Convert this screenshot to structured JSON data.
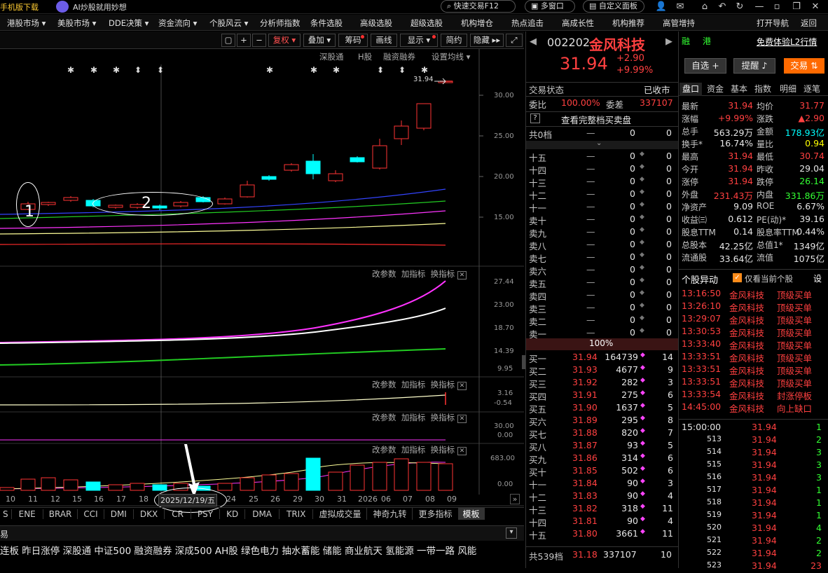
{
  "topbar": {
    "download": "手机版下载",
    "ai": "AI炒股就用妙想",
    "quick": "快速交易F12",
    "multi": "多窗口",
    "custom": "自定义面板"
  },
  "menu": [
    "港股市场 ▾",
    "美股市场 ▾",
    "DDE决策 ▾",
    "资金流向 ▾",
    "个股风云 ▾",
    "分析师指数",
    "条件选股",
    "高级选股",
    "超级选股",
    "机构增仓",
    "热点追击",
    "高成长性",
    "机构推荐",
    "高管增持",
    "打开导航",
    "返回"
  ],
  "toolbar": {
    "restore": "复权",
    "overlay": "叠加",
    "chips": "筹码",
    "draw": "画线",
    "display": "显示",
    "simple": "简约",
    "hide": "隐藏"
  },
  "sublinks": {
    "sgt": "深股通",
    "h": "H股",
    "margin": "融资融券",
    "ma": "设置均线"
  },
  "chart": {
    "last_label": "31.94",
    "yticks": [
      "30.00",
      "25.00",
      "20.00",
      "15.00"
    ],
    "ind_btns": [
      "改参数",
      "加指标",
      "换指标"
    ],
    "ind1_ticks": [
      "27.44",
      "23.00",
      "18.70",
      "14.39",
      "9.95"
    ],
    "ind2_ticks": [
      "3.16",
      "-0.54"
    ],
    "ind3_ticks": [
      "30.00",
      "0.00"
    ],
    "vol_ticks": [
      "683.00",
      "0.00"
    ],
    "xlabels": [
      "10",
      "11",
      "12",
      "15",
      "16",
      "17",
      "18",
      "2025/12/19/五",
      "24",
      "25",
      "26",
      "29",
      "30",
      "31",
      "2026",
      "06",
      "07",
      "08",
      "09"
    ],
    "annotation1": "1",
    "annotation2": "2"
  },
  "bottomtabs": [
    "S",
    "ENE",
    "BRAR",
    "CCI",
    "DMI",
    "DKX",
    "CR",
    "PSY",
    "KD",
    "DMA",
    "TRIX",
    "虚拟成交量",
    "神奇九转",
    "更多指标",
    "模板"
  ],
  "ticker": [
    "连板",
    "昨日涨停",
    "深股通",
    "中证500",
    "融资融券",
    "深成500",
    "AH股",
    "绿色电力",
    "抽水蓄能",
    "储能",
    "商业航天",
    "氢能源",
    "一带一路",
    "风能"
  ],
  "stock": {
    "code": "002202",
    "name": "金风科技",
    "price": "31.94",
    "chg": "+2.90",
    "pct": "+9.99%",
    "rong": "融",
    "gang": "港",
    "trial": "免费体验L2行情",
    "status_l": "交易状态",
    "status_r": "已收市",
    "weibi_l": "委比",
    "weibi": "100.00%",
    "weicha_l": "委差",
    "weicha": "337107",
    "full": "查看完整档买卖盘",
    "gong0": "共0档",
    "pct100": "100%",
    "gong539": "共539档",
    "gong_price": "31.18",
    "gong_vol": "337107",
    "gong_n": "10"
  },
  "asks": [
    "十五",
    "十四",
    "十三",
    "十二",
    "十一",
    "卖十",
    "卖九",
    "卖八",
    "卖七",
    "卖六",
    "卖五",
    "卖四",
    "卖三",
    "卖二",
    "卖一"
  ],
  "bids": [
    [
      "买一",
      "31.94",
      "164739",
      "14"
    ],
    [
      "买二",
      "31.93",
      "4677",
      "9"
    ],
    [
      "买三",
      "31.92",
      "282",
      "3"
    ],
    [
      "买四",
      "31.91",
      "275",
      "6"
    ],
    [
      "买五",
      "31.90",
      "1637",
      "5"
    ],
    [
      "买六",
      "31.89",
      "295",
      "8"
    ],
    [
      "买七",
      "31.88",
      "820",
      "7"
    ],
    [
      "买八",
      "31.87",
      "93",
      "5"
    ],
    [
      "买九",
      "31.86",
      "314",
      "6"
    ],
    [
      "买十",
      "31.85",
      "502",
      "6"
    ],
    [
      "十一",
      "31.84",
      "90",
      "3"
    ],
    [
      "十二",
      "31.83",
      "90",
      "4"
    ],
    [
      "十三",
      "31.82",
      "318",
      "11"
    ],
    [
      "十四",
      "31.81",
      "90",
      "4"
    ],
    [
      "十五",
      "31.80",
      "3661",
      "11"
    ]
  ],
  "actions": {
    "zixuan": "自选 +",
    "remind": "提醒",
    "trade": "交易"
  },
  "infotabs": [
    "盘口",
    "资金",
    "基本",
    "指数",
    "明细",
    "逐笔"
  ],
  "quote": [
    [
      "最新",
      "31.94",
      "red",
      "均价",
      "31.77",
      "red"
    ],
    [
      "涨幅",
      "+9.99%",
      "red",
      "涨跌",
      "▲2.90",
      "red"
    ],
    [
      "总手",
      "563.29万",
      "wht",
      "金额",
      "178.93亿",
      "cyn"
    ],
    [
      "换手*",
      "16.74%",
      "wht",
      "量比",
      "0.94",
      "yel"
    ],
    [
      "最高",
      "31.94",
      "red",
      "最低",
      "30.74",
      "red"
    ],
    [
      "今开",
      "31.94",
      "red",
      "昨收",
      "29.04",
      "wht"
    ],
    [
      "涨停",
      "31.94",
      "red",
      "跌停",
      "26.14",
      "grn"
    ],
    [
      "外盘",
      "231.43万",
      "red",
      "内盘",
      "331.86万",
      "grn"
    ],
    [
      "净资产",
      "9.09",
      "wht",
      "ROE",
      "6.67%",
      "wht"
    ],
    [
      "收益㈢",
      "0.612",
      "wht",
      "PE(动)*",
      "39.16",
      "wht"
    ],
    [
      "股息TTM",
      "0.14",
      "wht",
      "股息率TTM",
      "0.44%",
      "wht"
    ],
    [
      "总股本",
      "42.25亿",
      "wht",
      "总值1*",
      "1349亿",
      "wht"
    ],
    [
      "流通股",
      "33.64亿",
      "wht",
      "流值",
      "1075亿",
      "wht"
    ]
  ],
  "alerts": {
    "title": "个股异动",
    "only": "仅看当前个股",
    "set": "设",
    "rows": [
      [
        "13:16:50",
        "金风科技",
        "顶级买单"
      ],
      [
        "13:26:10",
        "金风科技",
        "顶级买单"
      ],
      [
        "13:29:07",
        "金风科技",
        "顶级买单"
      ],
      [
        "13:30:53",
        "金风科技",
        "顶级买单"
      ],
      [
        "13:33:40",
        "金风科技",
        "顶级买单"
      ],
      [
        "13:33:51",
        "金风科技",
        "顶级买单"
      ],
      [
        "13:33:51",
        "金风科技",
        "顶级买单"
      ],
      [
        "13:33:51",
        "金风科技",
        "顶级买单"
      ],
      [
        "13:33:54",
        "金风科技",
        "封涨停板"
      ],
      [
        "14:45:00",
        "金风科技",
        "向上缺口"
      ]
    ]
  },
  "ticks": [
    [
      "15:00:00",
      "31.94",
      "1"
    ],
    [
      "513",
      "31.94",
      "2"
    ],
    [
      "514",
      "31.94",
      "3"
    ],
    [
      "515",
      "31.94",
      "3"
    ],
    [
      "516",
      "31.94",
      "3"
    ],
    [
      "517",
      "31.94",
      "1"
    ],
    [
      "518",
      "31.94",
      "1"
    ],
    [
      "519",
      "31.94",
      "1"
    ],
    [
      "520",
      "31.94",
      "4"
    ],
    [
      "521",
      "31.94",
      "2"
    ],
    [
      "522",
      "31.94",
      "2"
    ],
    [
      "523",
      "31.94",
      "23"
    ]
  ]
}
